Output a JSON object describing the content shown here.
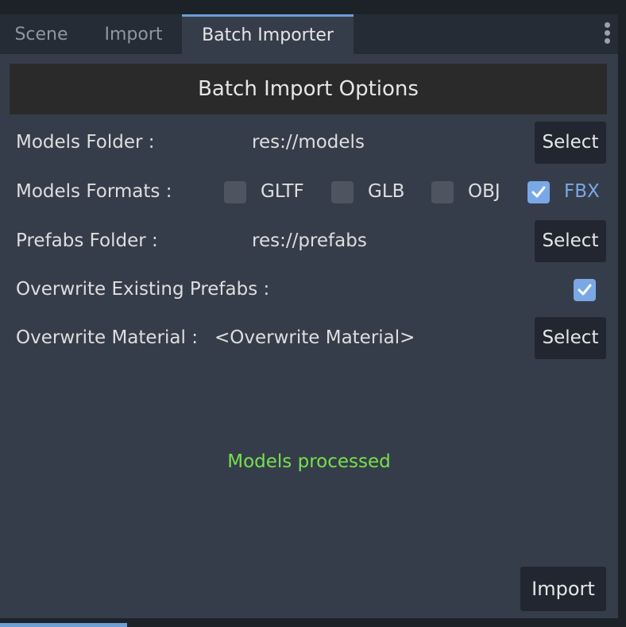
{
  "tabs": [
    {
      "label": "Scene"
    },
    {
      "label": "Import"
    },
    {
      "label": "Batch Importer"
    }
  ],
  "panel": {
    "title": "Batch Import Options",
    "models_folder": {
      "label": "Models Folder :",
      "value": "res://models",
      "button": "Select"
    },
    "models_formats": {
      "label": "Models Formats :",
      "options": [
        {
          "label": "GLTF",
          "checked": false
        },
        {
          "label": "GLB",
          "checked": false
        },
        {
          "label": "OBJ",
          "checked": false
        },
        {
          "label": "FBX",
          "checked": true
        }
      ]
    },
    "prefabs_folder": {
      "label": "Prefabs Folder :",
      "value": "res://prefabs",
      "button": "Select"
    },
    "overwrite_prefabs": {
      "label": "Overwrite Existing Prefabs :",
      "checked": true
    },
    "overwrite_material": {
      "label": "Overwrite Material :",
      "value": "<Overwrite Material>",
      "button": "Select"
    },
    "status": "Models processed",
    "import_button": "Import"
  },
  "colors": {
    "accent": "#7aa8e6",
    "status_green": "#76e04f",
    "panel_bg": "#363d4a"
  }
}
